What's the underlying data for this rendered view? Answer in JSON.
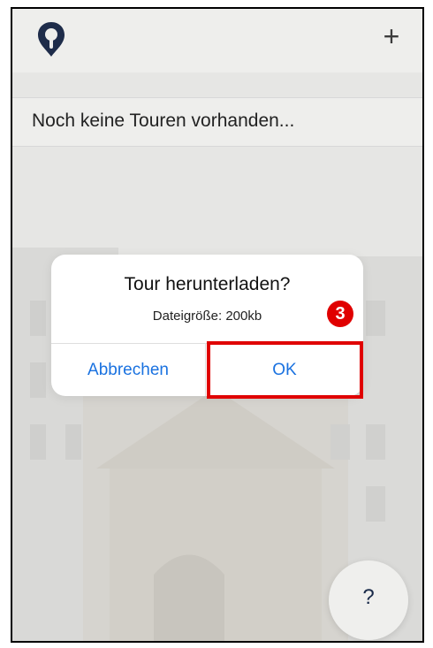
{
  "header": {
    "add_icon": "+",
    "logo_icon": "map-pin-logo-icon"
  },
  "list": {
    "empty_message": "Noch keine Touren vorhanden..."
  },
  "dialog": {
    "title": "Tour herunterladen?",
    "message": "Dateigröße: 200kb",
    "cancel_label": "Abbrechen",
    "ok_label": "OK"
  },
  "annotation": {
    "step_number": "3"
  },
  "help": {
    "label": "?"
  },
  "colors": {
    "accent": "#1a72e0",
    "highlight": "#e00000",
    "logo": "#1e2c4a"
  }
}
